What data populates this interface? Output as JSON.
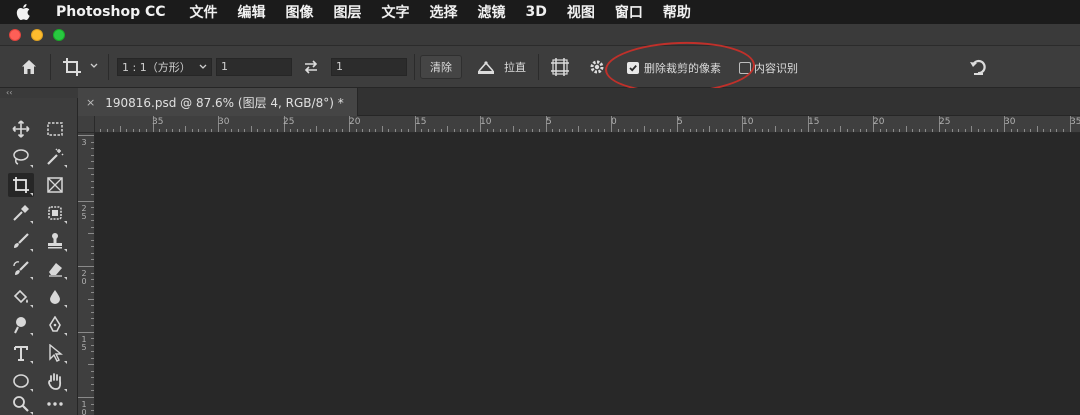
{
  "menubar": {
    "app_name": "Photoshop CC",
    "items": [
      "文件",
      "编辑",
      "图像",
      "图层",
      "文字",
      "选择",
      "滤镜",
      "3D",
      "视图",
      "窗口",
      "帮助"
    ]
  },
  "options": {
    "ratio_label": "1 : 1（方形）",
    "width_value": "1",
    "height_value": "1",
    "clear_label": "清除",
    "straighten_label": "拉直",
    "delete_cropped_label": "删除裁剪的像素",
    "delete_cropped_checked": true,
    "content_aware_label": "内容识别",
    "content_aware_checked": false
  },
  "tab": {
    "close": "×",
    "title": "190816.psd @ 87.6% (图层 4, RGB/8°) *"
  },
  "collapse": "‹‹",
  "ruler": {
    "h_labels": [
      "35",
      "30",
      "25",
      "20",
      "15",
      "10",
      "5",
      "0",
      "5",
      "10",
      "15",
      "20",
      "25",
      "30",
      "35"
    ],
    "v_labels": [
      "3",
      "2 5",
      "2 0",
      "1 5",
      "1 0"
    ]
  },
  "tools": [
    "move-icon",
    "marquee-icon",
    "lasso-icon",
    "magic-wand-icon",
    "crop-icon",
    "frame-icon",
    "eyedropper-icon",
    "healing-icon",
    "brush-icon",
    "stamp-icon",
    "history-brush-icon",
    "eraser-icon",
    "paint-bucket-icon",
    "blur-icon",
    "dodge-icon",
    "pen-icon",
    "type-icon",
    "path-selection-icon",
    "ellipse-icon",
    "hand-icon",
    "zoom-icon",
    "more-tools-icon"
  ],
  "colors": {
    "annotation": "#c0302a",
    "close_light": "#fe5f57",
    "min_light": "#febc2e",
    "max_light": "#28c840"
  }
}
